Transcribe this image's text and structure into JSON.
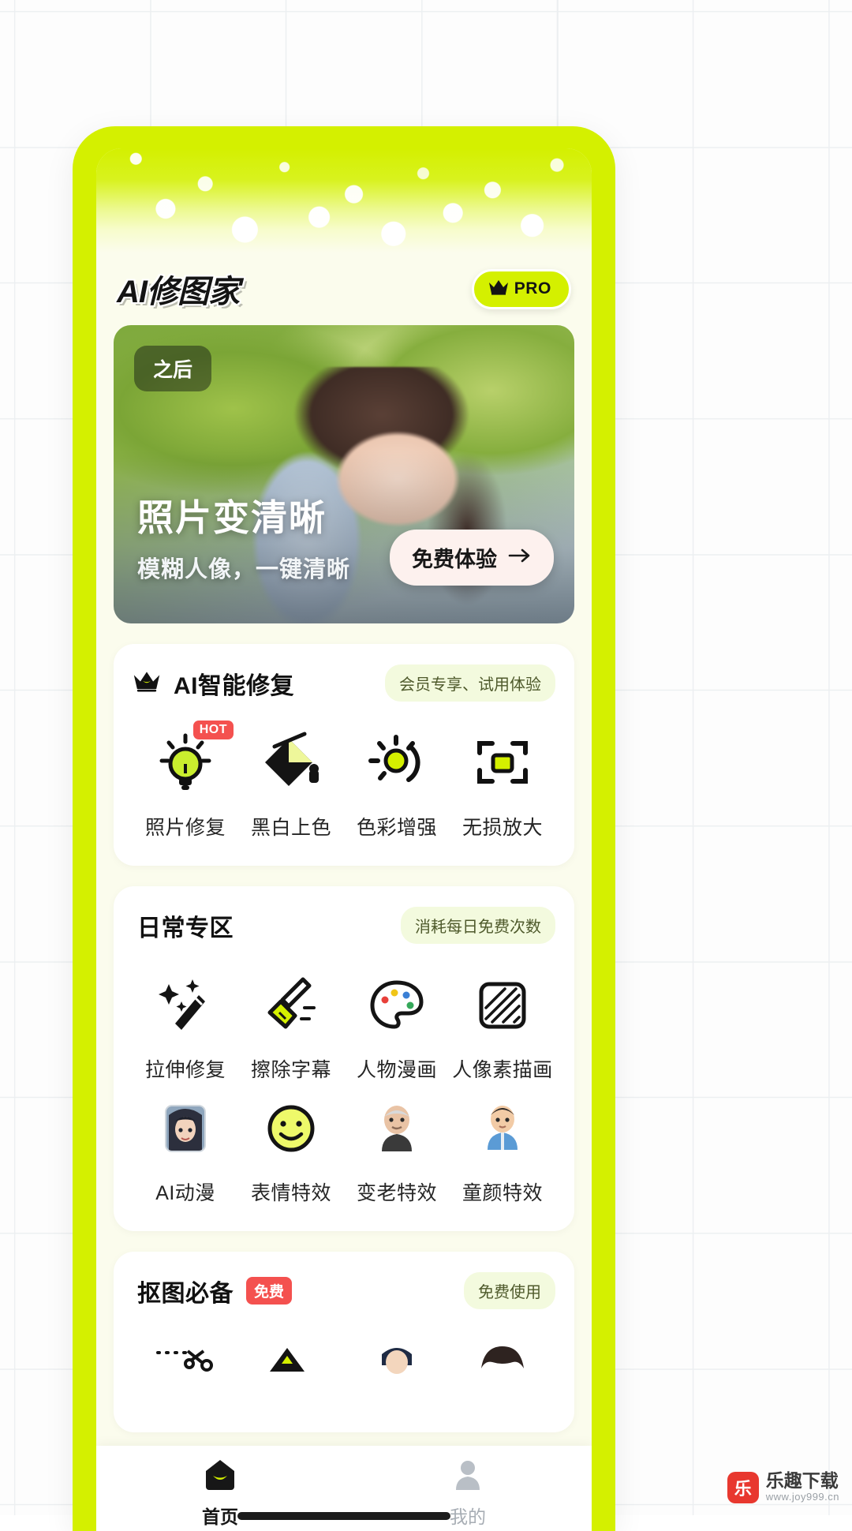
{
  "app": {
    "title": "AI修图家",
    "pro_label": "PRO",
    "pro_icon": "crown-icon"
  },
  "hero": {
    "badge": "之后",
    "headline": "照片变清晰",
    "subhead": "模糊人像，一键清晰",
    "cta_label": "免费体验",
    "cta_icon": "arrow-right-icon"
  },
  "sections": [
    {
      "key": "ai-repair",
      "title": "AI智能修复",
      "has_crown": true,
      "note": "会员专享、试用体验",
      "items": [
        {
          "label": "照片修复",
          "icon": "lightbulb-icon",
          "badge": "HOT"
        },
        {
          "label": "黑白上色",
          "icon": "paint-bucket-icon",
          "badge": ""
        },
        {
          "label": "色彩增强",
          "icon": "brightness-sun-icon",
          "badge": ""
        },
        {
          "label": "无损放大",
          "icon": "expand-frame-icon",
          "badge": ""
        }
      ]
    },
    {
      "key": "daily",
      "title": "日常专区",
      "has_crown": false,
      "note": "消耗每日免费次数",
      "items": [
        {
          "label": "拉伸修复",
          "icon": "magic-wand-icon",
          "badge": ""
        },
        {
          "label": "擦除字幕",
          "icon": "broom-icon",
          "badge": ""
        },
        {
          "label": "人物漫画",
          "icon": "palette-icon",
          "badge": ""
        },
        {
          "label": "人像素描画",
          "icon": "sketch-square-icon",
          "badge": ""
        },
        {
          "label": "AI动漫",
          "icon": "anime-portrait-icon",
          "badge": ""
        },
        {
          "label": "表情特效",
          "icon": "smiley-face-icon",
          "badge": ""
        },
        {
          "label": "变老特效",
          "icon": "old-man-icon",
          "badge": ""
        },
        {
          "label": "童颜特效",
          "icon": "young-boy-icon",
          "badge": ""
        }
      ]
    },
    {
      "key": "cutout",
      "title": "抠图必备",
      "has_crown": false,
      "tag": "免费",
      "note": "免费使用",
      "items": [
        {
          "label": "",
          "icon": "scissors-cutout-icon",
          "badge": ""
        },
        {
          "label": "",
          "icon": "mountain-photo-icon",
          "badge": ""
        },
        {
          "label": "",
          "icon": "portrait-cutout-icon",
          "badge": ""
        },
        {
          "label": "",
          "icon": "hair-cutout-icon",
          "badge": ""
        }
      ]
    }
  ],
  "nav": [
    {
      "label": "首页",
      "icon": "home-icon",
      "active": true
    },
    {
      "label": "我的",
      "icon": "person-icon",
      "active": false
    }
  ],
  "watermark": {
    "name": "乐趣下载",
    "url": "www.joy999.cn"
  },
  "colors": {
    "brand_green": "#d4f000",
    "accent_red": "#f4514f",
    "screen_bg": "#fbfced",
    "card_bg": "#ffffff",
    "text_dark": "#141414",
    "text_muted": "#a7adb4"
  }
}
